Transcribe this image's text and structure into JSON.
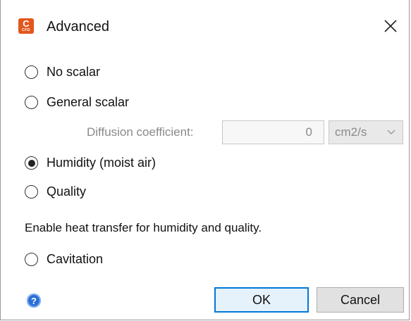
{
  "window": {
    "title": "Advanced",
    "app_icon_letter": "C",
    "app_icon_subtext": "CFD"
  },
  "options": {
    "no_scalar": "No scalar",
    "general_scalar": "General scalar",
    "humidity": "Humidity (moist air)",
    "quality": "Quality",
    "cavitation": "Cavitation",
    "selected": "humidity"
  },
  "diffusion": {
    "label": "Diffusion coefficient:",
    "value": "0",
    "unit": "cm2/s"
  },
  "info_text": "Enable heat transfer for humidity and quality.",
  "buttons": {
    "ok": "OK",
    "cancel": "Cancel"
  },
  "colors": {
    "accent": "#0078d7",
    "app_icon": "#e2571d",
    "help_icon": "#2b6fd6"
  }
}
